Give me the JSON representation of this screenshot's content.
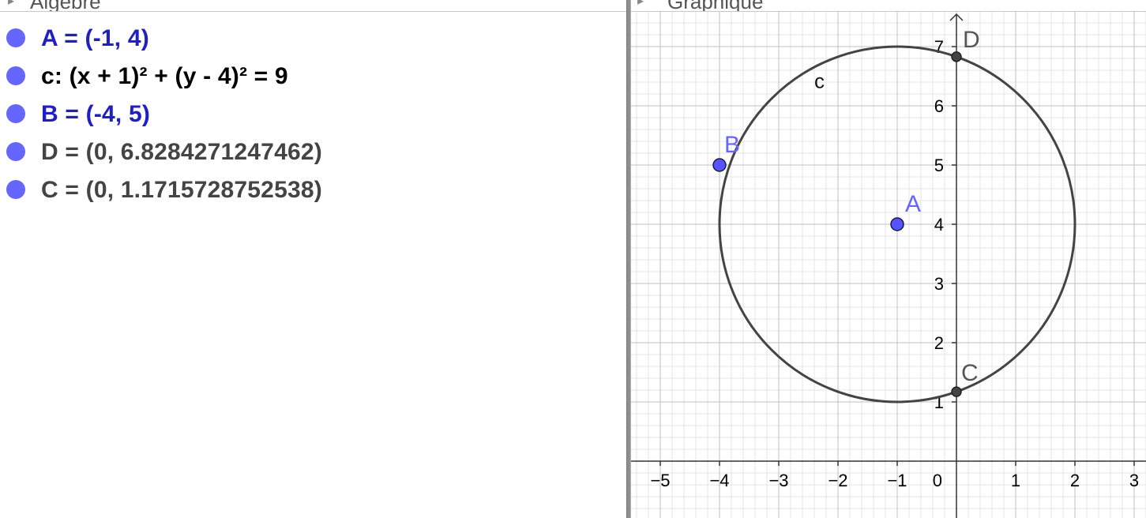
{
  "algebra_panel": {
    "title": "Algèbre",
    "items": [
      {
        "text": "A = (-1, 4)",
        "color": "#2020c0",
        "bullet_color": "#6666ff"
      },
      {
        "text": "c: (x + 1)² + (y - 4)² = 9",
        "color": "#000000",
        "bullet_color": "#6666ff"
      },
      {
        "text": "B = (-4, 5)",
        "color": "#2020c0",
        "bullet_color": "#6666ff"
      },
      {
        "text": "D = (0, 6.8284271247462)",
        "color": "#444444",
        "bullet_color": "#6666ff"
      },
      {
        "text": "C = (0, 1.1715728752538)",
        "color": "#444444",
        "bullet_color": "#6666ff"
      }
    ]
  },
  "graphics_panel": {
    "title": "Graphique",
    "x_ticks": [
      {
        "value": -5,
        "label": "−5"
      },
      {
        "value": -4,
        "label": "−4"
      },
      {
        "value": -3,
        "label": "−3"
      },
      {
        "value": -2,
        "label": "−2"
      },
      {
        "value": -1,
        "label": "−1"
      },
      {
        "value": 1,
        "label": "1"
      },
      {
        "value": 2,
        "label": "2"
      },
      {
        "value": 3,
        "label": "3"
      }
    ],
    "y_ticks": [
      {
        "value": 1,
        "label": "1"
      },
      {
        "value": 2,
        "label": "2"
      },
      {
        "value": 3,
        "label": "3"
      },
      {
        "value": 4,
        "label": "4"
      },
      {
        "value": 5,
        "label": "5"
      },
      {
        "value": 6,
        "label": "6"
      },
      {
        "value": 7,
        "label": "7"
      }
    ],
    "origin_label": "0",
    "circle": {
      "label": "c",
      "cx": -1,
      "cy": 4,
      "r": 3,
      "color": "#444444"
    },
    "points": [
      {
        "name": "A",
        "x": -1,
        "y": 4,
        "color": "#5555ff",
        "label_color": "#6666ff"
      },
      {
        "name": "B",
        "x": -4,
        "y": 5,
        "color": "#5555ff",
        "label_color": "#6666ff"
      },
      {
        "name": "D",
        "x": 0,
        "y": 6.8284271247462,
        "color": "#444444",
        "label_color": "#555555"
      },
      {
        "name": "C",
        "x": 0,
        "y": 1.1715728752538,
        "color": "#444444",
        "label_color": "#555555"
      }
    ]
  }
}
